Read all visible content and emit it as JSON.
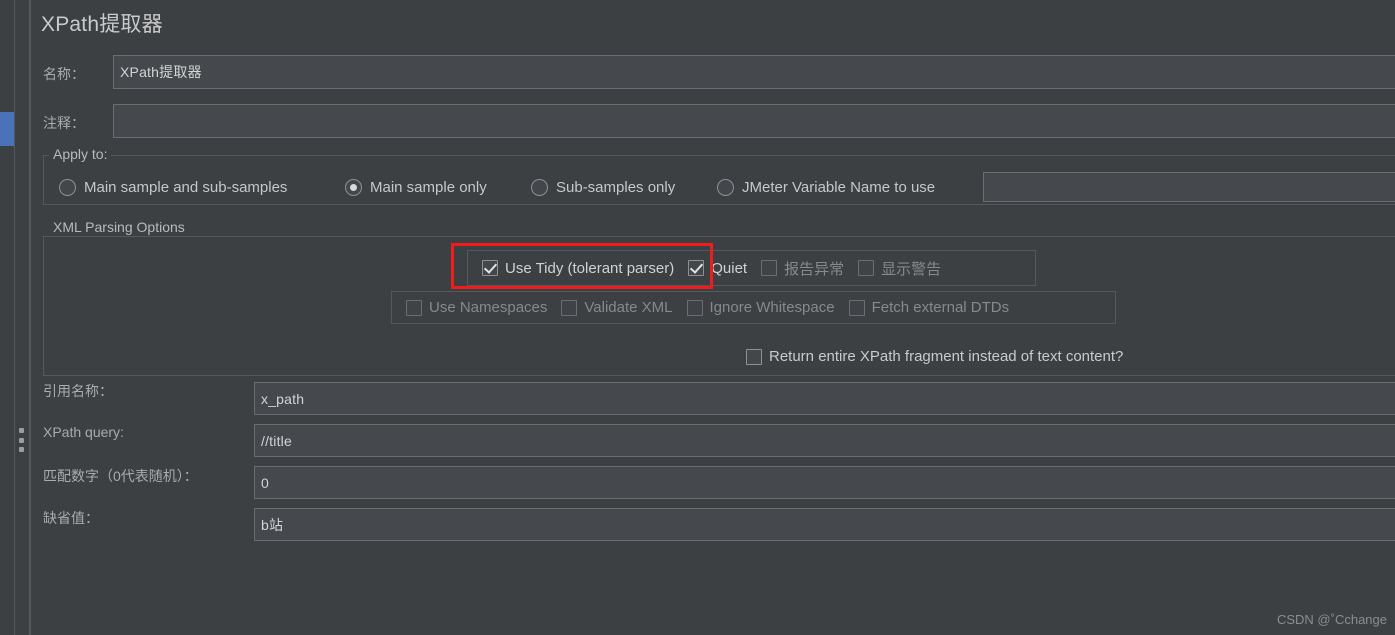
{
  "window": {
    "title": "XPath提取器"
  },
  "fields": {
    "name": {
      "label": "名称：",
      "value": "XPath提取器"
    },
    "comment": {
      "label": "注释：",
      "value": ""
    },
    "ref_name": {
      "label": "引用名称：",
      "value": "x_path"
    },
    "xpath_query": {
      "label": "XPath query:",
      "value": "//title"
    },
    "match_no": {
      "label": "匹配数字（0代表随机）：",
      "value": "0"
    },
    "default_value": {
      "label": "缺省值：",
      "value": "b站"
    }
  },
  "apply_to": {
    "title": "Apply to:",
    "options": [
      {
        "label": "Main sample and sub-samples",
        "selected": false
      },
      {
        "label": "Main sample only",
        "selected": true
      },
      {
        "label": "Sub-samples only",
        "selected": false
      },
      {
        "label": "JMeter Variable Name to use",
        "selected": false
      }
    ],
    "variable_name_value": ""
  },
  "xml_parsing": {
    "title": "XML Parsing Options",
    "row1": [
      {
        "label": "Use Tidy (tolerant parser)",
        "checked": true,
        "disabled": false
      },
      {
        "label": "Quiet",
        "checked": true,
        "disabled": false
      },
      {
        "label": "报告异常",
        "checked": false,
        "disabled": true
      },
      {
        "label": "显示警告",
        "checked": false,
        "disabled": true
      }
    ],
    "row2": [
      {
        "label": "Use Namespaces",
        "checked": false,
        "disabled": true
      },
      {
        "label": "Validate XML",
        "checked": false,
        "disabled": true
      },
      {
        "label": "Ignore Whitespace",
        "checked": false,
        "disabled": true
      },
      {
        "label": "Fetch external DTDs",
        "checked": false,
        "disabled": true
      }
    ],
    "return_fragment": {
      "label": "Return entire XPath fragment instead of text content?",
      "checked": false
    }
  },
  "highlight": {
    "color": "#f21b1b"
  },
  "watermark": {
    "text": "CSDN @˚Cchange"
  }
}
